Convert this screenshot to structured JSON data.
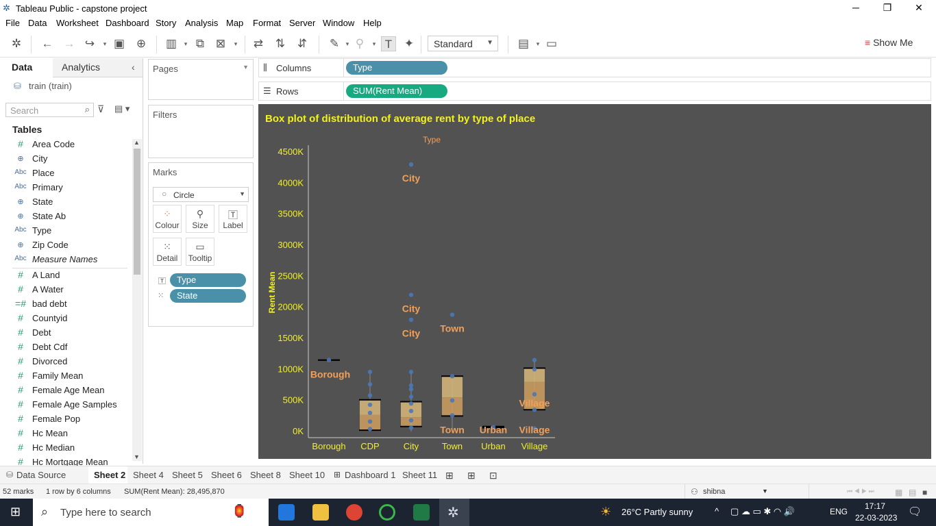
{
  "window": {
    "title": "Tableau Public - capstone project"
  },
  "menu": [
    "File",
    "Data",
    "Worksheet",
    "Dashboard",
    "Story",
    "Analysis",
    "Map",
    "Format",
    "Server",
    "Window",
    "Help"
  ],
  "toolbar": {
    "fit_select": "Standard",
    "show_me": "Show Me"
  },
  "left_panel": {
    "tab_data": "Data",
    "tab_analytics": "Analytics",
    "datasource": "train (train)",
    "search_placeholder": "Search",
    "tables_header": "Tables",
    "fields": [
      {
        "icon": "hash",
        "name": "Area Code"
      },
      {
        "icon": "globe",
        "name": "City"
      },
      {
        "icon": "abc",
        "name": "Place"
      },
      {
        "icon": "abc",
        "name": "Primary"
      },
      {
        "icon": "globe",
        "name": "State"
      },
      {
        "icon": "globe",
        "name": "State Ab"
      },
      {
        "icon": "abc",
        "name": "Type"
      },
      {
        "icon": "globe",
        "name": "Zip Code"
      },
      {
        "icon": "abc",
        "name": "Measure Names"
      },
      {
        "icon": "hash",
        "name": "A Land"
      },
      {
        "icon": "hash",
        "name": "A Water"
      },
      {
        "icon": "hash-calc",
        "name": "bad debt"
      },
      {
        "icon": "hash",
        "name": "Countyid"
      },
      {
        "icon": "hash",
        "name": "Debt"
      },
      {
        "icon": "hash",
        "name": "Debt Cdf"
      },
      {
        "icon": "hash",
        "name": "Divorced"
      },
      {
        "icon": "hash",
        "name": "Family Mean"
      },
      {
        "icon": "hash",
        "name": "Female Age Mean"
      },
      {
        "icon": "hash",
        "name": "Female Age Samples"
      },
      {
        "icon": "hash",
        "name": "Female Pop"
      },
      {
        "icon": "hash",
        "name": "Hc Mean"
      },
      {
        "icon": "hash",
        "name": "Hc Median"
      },
      {
        "icon": "hash",
        "name": "Hc Mortgage Mean"
      }
    ]
  },
  "cards": {
    "pages": "Pages",
    "filters": "Filters",
    "marks": "Marks",
    "mark_type": "Circle",
    "buttons": [
      "Colour",
      "Size",
      "Label",
      "Detail",
      "Tooltip"
    ],
    "mark_pills": [
      "Type",
      "State"
    ]
  },
  "shelves": {
    "columns_label": "Columns",
    "columns_pill": "Type",
    "rows_label": "Rows",
    "rows_pill": "SUM(Rent Mean)"
  },
  "chart_data": {
    "type": "box",
    "title": "Box plot of distribution of average rent by type of place",
    "header": "Type",
    "ylabel": "Rent Mean",
    "categories": [
      "Borough",
      "CDP",
      "City",
      "Town",
      "Urban",
      "Village"
    ],
    "y_ticks": [
      "0K",
      "500K",
      "1000K",
      "1500K",
      "2000K",
      "2500K",
      "3000K",
      "3500K",
      "4000K",
      "4500K"
    ],
    "ylim": [
      0,
      4500000
    ],
    "boxes": [
      {
        "category": "Borough",
        "q1": 1150000,
        "median": 1150000,
        "q3": 1150000,
        "whisker_low": 1150000,
        "whisker_high": 1150000
      },
      {
        "category": "CDP",
        "q1": 20000,
        "median": 270000,
        "q3": 510000,
        "whisker_low": 0,
        "whisker_high": 960000
      },
      {
        "category": "City",
        "q1": 80000,
        "median": 230000,
        "q3": 480000,
        "whisker_low": 0,
        "whisker_high": 960000
      },
      {
        "category": "Town",
        "q1": 250000,
        "median": 550000,
        "q3": 890000,
        "whisker_low": 0,
        "whisker_high": 890000
      },
      {
        "category": "Urban",
        "q1": 60000,
        "median": 70000,
        "q3": 80000,
        "whisker_low": 60000,
        "whisker_high": 80000
      },
      {
        "category": "Village",
        "q1": 350000,
        "median": 800000,
        "q3": 1020000,
        "whisker_low": 350000,
        "whisker_high": 1150000
      }
    ],
    "points": [
      {
        "category": "City",
        "y": 4300000
      },
      {
        "category": "City",
        "y": 2200000
      },
      {
        "category": "City",
        "y": 1800000
      },
      {
        "category": "Town",
        "y": 1880000
      },
      {
        "category": "Borough",
        "y": 1150000
      },
      {
        "category": "CDP",
        "y": 960000
      },
      {
        "category": "CDP",
        "y": 760000
      },
      {
        "category": "CDP",
        "y": 580000
      },
      {
        "category": "CDP",
        "y": 430000
      },
      {
        "category": "CDP",
        "y": 300000
      },
      {
        "category": "CDP",
        "y": 160000
      },
      {
        "category": "CDP",
        "y": 40000
      },
      {
        "category": "City",
        "y": 960000
      },
      {
        "category": "City",
        "y": 740000
      },
      {
        "category": "City",
        "y": 680000
      },
      {
        "category": "City",
        "y": 560000
      },
      {
        "category": "City",
        "y": 450000
      },
      {
        "category": "City",
        "y": 330000
      },
      {
        "category": "City",
        "y": 180000
      },
      {
        "category": "City",
        "y": 60000
      },
      {
        "category": "Town",
        "y": 890000
      },
      {
        "category": "Town",
        "y": 500000
      },
      {
        "category": "Town",
        "y": 260000
      },
      {
        "category": "Urban",
        "y": 70000
      },
      {
        "category": "Village",
        "y": 1150000
      },
      {
        "category": "Village",
        "y": 1000000
      },
      {
        "category": "Village",
        "y": 600000
      },
      {
        "category": "Village",
        "y": 350000
      },
      {
        "category": "Village",
        "y": 50000
      }
    ],
    "labels": [
      {
        "text": "City",
        "category": "City",
        "y": 4080000
      },
      {
        "text": "City",
        "category": "City",
        "y": 1980000
      },
      {
        "text": "City",
        "category": "City",
        "y": 1580000
      },
      {
        "text": "Town",
        "category": "Town",
        "y": 1660000
      },
      {
        "text": "Borough",
        "category": "Borough",
        "y": 920000
      },
      {
        "text": "Town",
        "category": "Town",
        "y": 30000
      },
      {
        "text": "Urban",
        "category": "Urban",
        "y": 30000
      },
      {
        "text": "Village",
        "category": "Village",
        "y": 30000
      },
      {
        "text": "Village",
        "category": "Village",
        "y": 460000
      }
    ]
  },
  "sheet_tabs": [
    "Data Source",
    "Sheet 2",
    "Sheet 4",
    "Sheet 5",
    "Sheet 6",
    "Sheet 8",
    "Sheet 10",
    "Dashboard 1",
    "Sheet 11"
  ],
  "status": {
    "marks": "52 marks",
    "dims": "1 row by 6 columns",
    "sum": "SUM(Rent Mean): 28,495,870",
    "user": "shibna"
  },
  "taskbar": {
    "search": "Type here to search",
    "weather": "26°C  Partly sunny",
    "lang": "ENG",
    "time": "17:17",
    "date": "22-03-2023"
  },
  "colors": {
    "chart_bg": "#525252",
    "title": "#f2f21f",
    "axis_text": "#f2f21f",
    "label": "#f0a05a",
    "point": "#4a78b8",
    "box": "#d9b87a"
  }
}
